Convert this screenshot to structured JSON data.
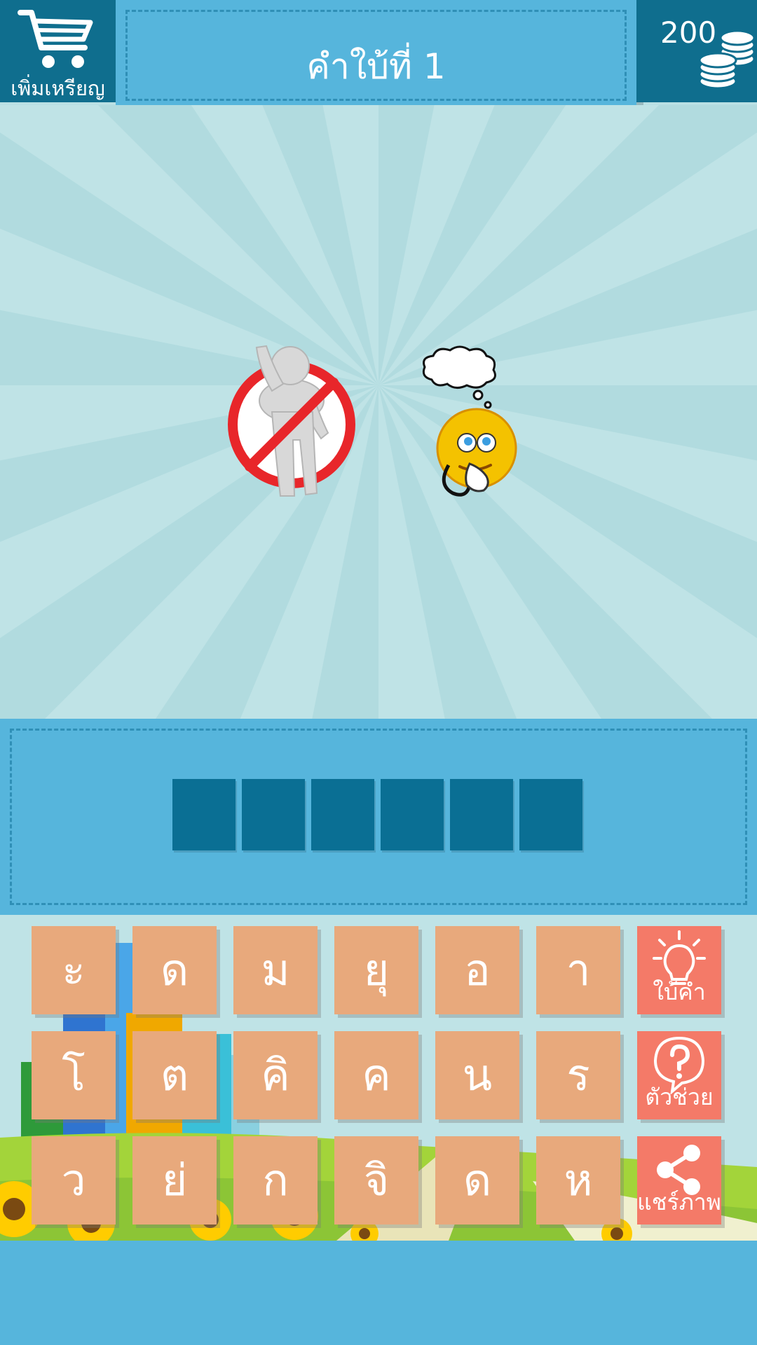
{
  "header": {
    "shop_label": "เพิ่มเหรียญ",
    "clue_title": "คำใบ้ที่ 1",
    "coin_count": "200"
  },
  "clue_images": [
    "no-entry-person",
    "thinking-smiley"
  ],
  "answer": {
    "slot_count": 6
  },
  "keyboard": {
    "rows": [
      [
        "ะ",
        "ด",
        "ม",
        "ยุ",
        "อ",
        "า"
      ],
      [
        "โ",
        "ต",
        "คิ",
        "ค",
        "น",
        "ร"
      ],
      [
        "ว",
        "ย่",
        "ก",
        "จิ",
        "ด",
        "ห"
      ]
    ],
    "tools": [
      {
        "label": "ใบ้คำ",
        "icon": "lightbulb-icon"
      },
      {
        "label": "ตัวช่วย",
        "icon": "question-bubble-icon"
      },
      {
        "label": "แชร์ภาพ",
        "icon": "share-icon"
      }
    ]
  },
  "colors": {
    "dark_teal": "#0f6e8e",
    "panel_blue": "#56b5dc",
    "slot_blue": "#0a6f94",
    "key_peach": "#e8a97c",
    "tool_coral": "#f47a68",
    "background_light": "#bfe3e6"
  }
}
